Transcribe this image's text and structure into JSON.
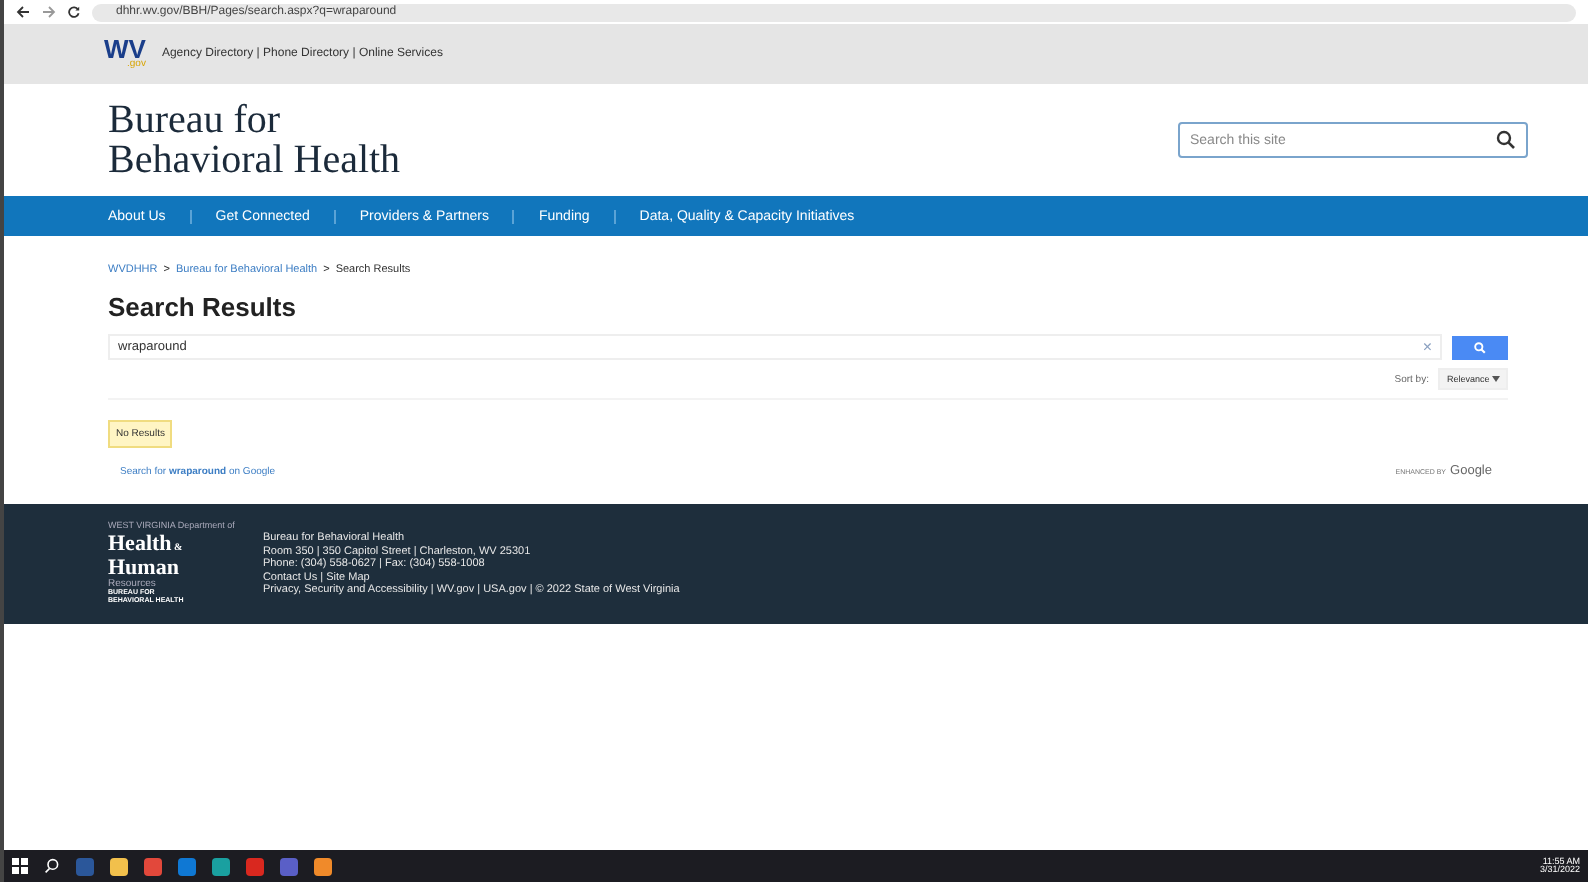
{
  "browser": {
    "url": "dhhr.wv.gov/BBH/Pages/search.aspx?q=wraparound"
  },
  "top_bar": {
    "logo": "WV",
    "logo_sub": ".gov",
    "links": "Agency Directory | Phone Directory | Online Services"
  },
  "header": {
    "title_line_1": "Bureau for",
    "title_line_2": "Behavioral Health",
    "search": {
      "placeholder": "Search this site"
    }
  },
  "nav": [
    {
      "label": "About Us"
    },
    {
      "label": "Get Connected"
    },
    {
      "label": "Providers & Partners"
    },
    {
      "label": "Funding"
    },
    {
      "label": "Data, Quality & Capacity Initiatives"
    }
  ],
  "breadcrumb": [
    {
      "label": "WVDHHR",
      "link": true
    },
    {
      "label": "Bureau for Behavioral Health",
      "link": true
    },
    {
      "label": "Search Results",
      "link": false
    }
  ],
  "breadcrumb_separator": ">",
  "heading": "Search Results",
  "search": {
    "value": "wraparound",
    "clear": "×",
    "sort_label": "Sort by:",
    "sort_value": "Relevance"
  },
  "no_results": "No Results",
  "google_link": "Search for **wraparound** on Google",
  "enhanced_label": "ENHANCED BY",
  "enhanced_brand": "Google",
  "footer": {
    "logo": {
      "top": "WEST VIRGINIA Department of",
      "health": "Health",
      "amp": "&",
      "human": "Human",
      "resources": "Resources",
      "bureau": "BUREAU FOR",
      "bureau_name": "BEHAVIORAL HEALTH"
    },
    "lines": [
      "Bureau for Behavioral Health",
      "Room 350 | 350 Capitol Street | Charleston, WV 25301",
      "Phone: (304) 558-0627 | Fax: (304) 558-1008",
      "Contact Us | Site Map",
      "Privacy, Security and Accessibility | WV.gov | USA.gov | © 2022 State of West Virginia"
    ]
  },
  "taskbar": {
    "apps": [
      {
        "color": "#2b579a"
      },
      {
        "color": "#f2c04c"
      },
      {
        "color": "#e2483b"
      },
      {
        "color": "#0f78d4"
      },
      {
        "color": "#1aa0a0"
      },
      {
        "color": "#d9281f"
      },
      {
        "color": "#5a5fc7"
      },
      {
        "color": "#f08a2a"
      }
    ],
    "time": "11:55 AM",
    "date": "3/31/2022"
  }
}
